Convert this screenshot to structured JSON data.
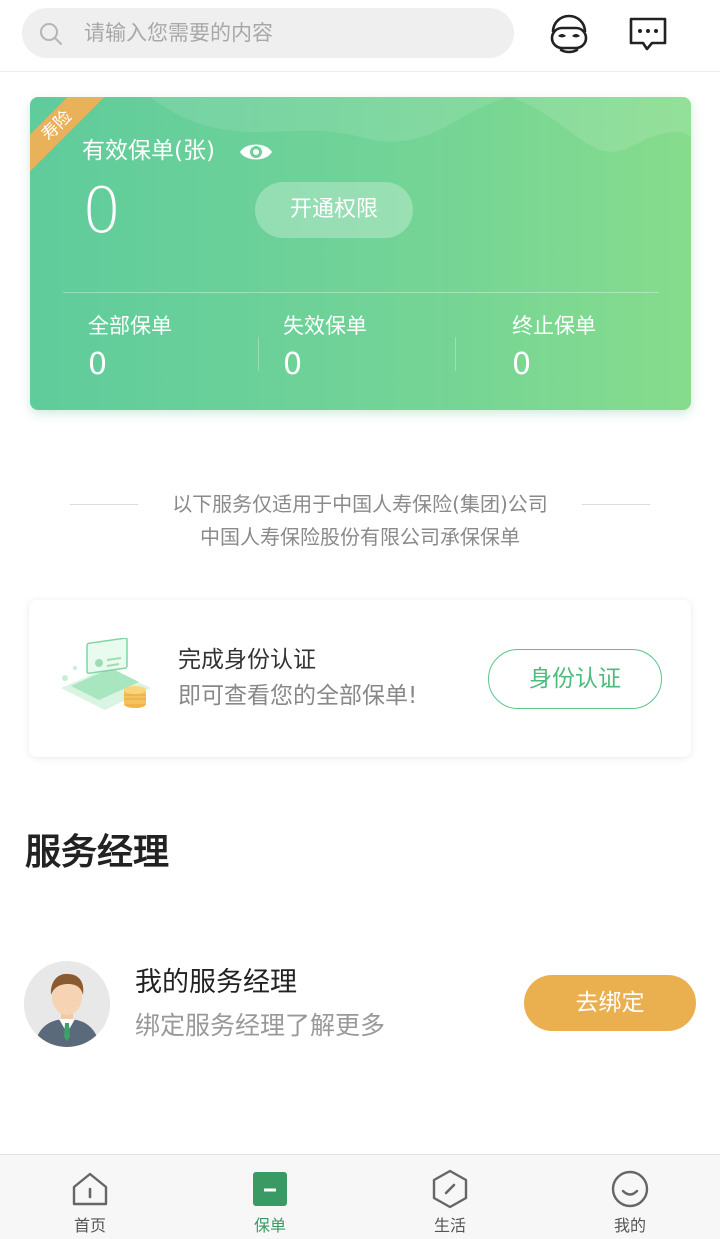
{
  "header": {
    "search_placeholder": "请输入您需要的内容",
    "icons": [
      "search-icon",
      "robot-service-icon",
      "message-icon"
    ]
  },
  "policy_card": {
    "ribbon": "寿险",
    "title": "有效保单(张)",
    "count": "0",
    "open_button": "开通权限",
    "stats": [
      {
        "label": "全部保单",
        "value": "0"
      },
      {
        "label": "失效保单",
        "value": "0"
      },
      {
        "label": "终止保单",
        "value": "0"
      }
    ],
    "colors": {
      "gradient_start": "#5fcc9c",
      "gradient_end": "#86dc8c",
      "ribbon": "#e8b15a"
    }
  },
  "notice": {
    "line1": "以下服务仅适用于中国人寿保险(集团)公司",
    "line2": "中国人寿保险股份有限公司承保保单"
  },
  "identity": {
    "title": "完成身份认证",
    "subtitle": "即可查看您的全部保单!",
    "button": "身份认证",
    "accent": "#4cbb7b"
  },
  "service_manager": {
    "section_title": "服务经理",
    "name": "我的服务经理",
    "desc": "绑定服务经理了解更多",
    "button": "去绑定",
    "button_color": "#eab04f"
  },
  "tabbar": {
    "items": [
      {
        "label": "首页",
        "icon": "home-icon",
        "active": false
      },
      {
        "label": "保单",
        "icon": "policy-icon",
        "active": true
      },
      {
        "label": "生活",
        "icon": "life-icon",
        "active": false
      },
      {
        "label": "我的",
        "icon": "profile-icon",
        "active": false
      }
    ],
    "active_color": "#3a9a64"
  }
}
